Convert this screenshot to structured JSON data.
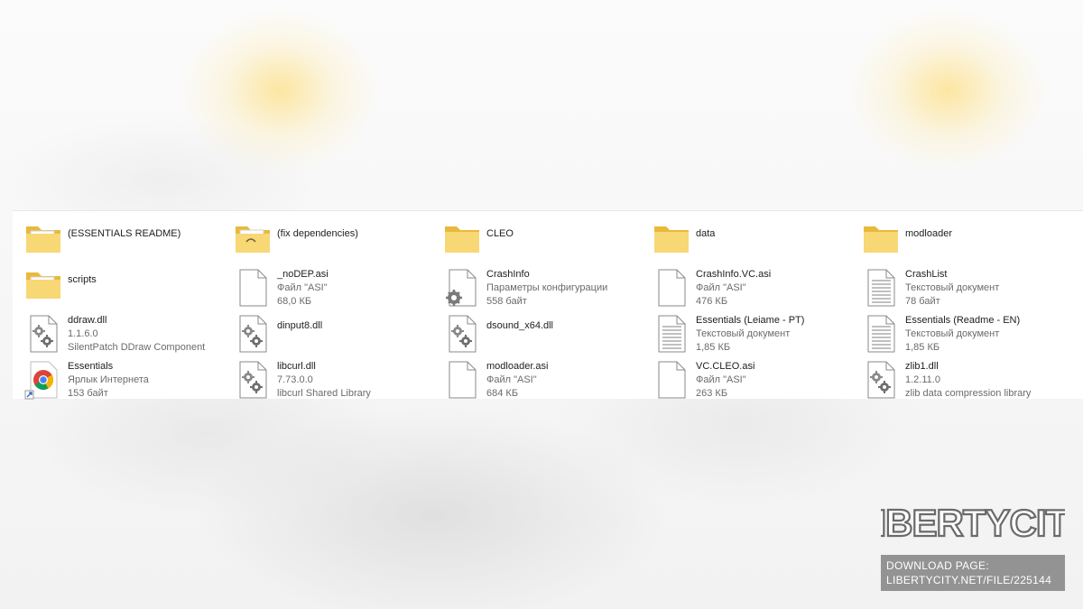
{
  "explorer": {
    "items": [
      {
        "name": "(ESSENTIALS README)",
        "kind": "folder",
        "icon": "folder-with-files-icon"
      },
      {
        "name": "(fix dependencies)",
        "kind": "folder",
        "icon": "folder-with-image-icon"
      },
      {
        "name": "CLEO",
        "kind": "folder",
        "icon": "folder-icon"
      },
      {
        "name": "data",
        "kind": "folder",
        "icon": "folder-icon"
      },
      {
        "name": "modloader",
        "kind": "folder",
        "icon": "folder-icon"
      },
      {
        "name": "scripts",
        "kind": "folder",
        "icon": "folder-with-files-icon"
      },
      {
        "name": "_noDEP.asi",
        "line2": "Файл \"ASI\"",
        "line3": "68,0 КБ",
        "icon": "blank-file-icon"
      },
      {
        "name": "CrashInfo",
        "line2": "Параметры конфигурации",
        "line3": "558 байт",
        "icon": "config-file-icon"
      },
      {
        "name": "CrashInfo.VC.asi",
        "line2": "Файл \"ASI\"",
        "line3": "476 КБ",
        "icon": "blank-file-icon"
      },
      {
        "name": "CrashList",
        "line2": "Текстовый документ",
        "line3": "78 байт",
        "icon": "text-file-icon"
      },
      {
        "name": "ddraw.dll",
        "line2": "1.1.6.0",
        "line3": "SilentPatch DDraw Component",
        "icon": "dll-file-icon"
      },
      {
        "name": "dinput8.dll",
        "icon": "dll-file-icon"
      },
      {
        "name": "dsound_x64.dll",
        "icon": "dll-file-icon"
      },
      {
        "name": "Essentials (Leiame - PT)",
        "line2": "Текстовый документ",
        "line3": "1,85 КБ",
        "icon": "text-file-icon"
      },
      {
        "name": "Essentials (Readme - EN)",
        "line2": "Текстовый документ",
        "line3": "1,85 КБ",
        "icon": "text-file-icon"
      },
      {
        "name": "Essentials",
        "line2": "Ярлык Интернета",
        "line3": "153 байт",
        "icon": "chrome-shortcut-icon"
      },
      {
        "name": "libcurl.dll",
        "line2": "7.73.0.0",
        "line3": "libcurl Shared Library",
        "icon": "dll-file-icon"
      },
      {
        "name": "modloader.asi",
        "line2": "Файл \"ASI\"",
        "line3": "684 КБ",
        "icon": "blank-file-icon"
      },
      {
        "name": "VC.CLEO.asi",
        "line2": "Файл \"ASI\"",
        "line3": "263 КБ",
        "icon": "blank-file-icon"
      },
      {
        "name": "zlib1.dll",
        "line2": "1.2.11.0",
        "line3": "zlib data compression library",
        "icon": "dll-file-icon"
      }
    ]
  },
  "watermark": {
    "logo_text": "LibertyCity",
    "download_line1": "DOWNLOAD PAGE:",
    "download_line2": "LIBERTYCITY.NET/FILE/225144"
  },
  "colors": {
    "folder": "#f8d775",
    "folder_dark": "#e9b93c",
    "text": "#202020",
    "subtext": "#6b6b6b"
  }
}
